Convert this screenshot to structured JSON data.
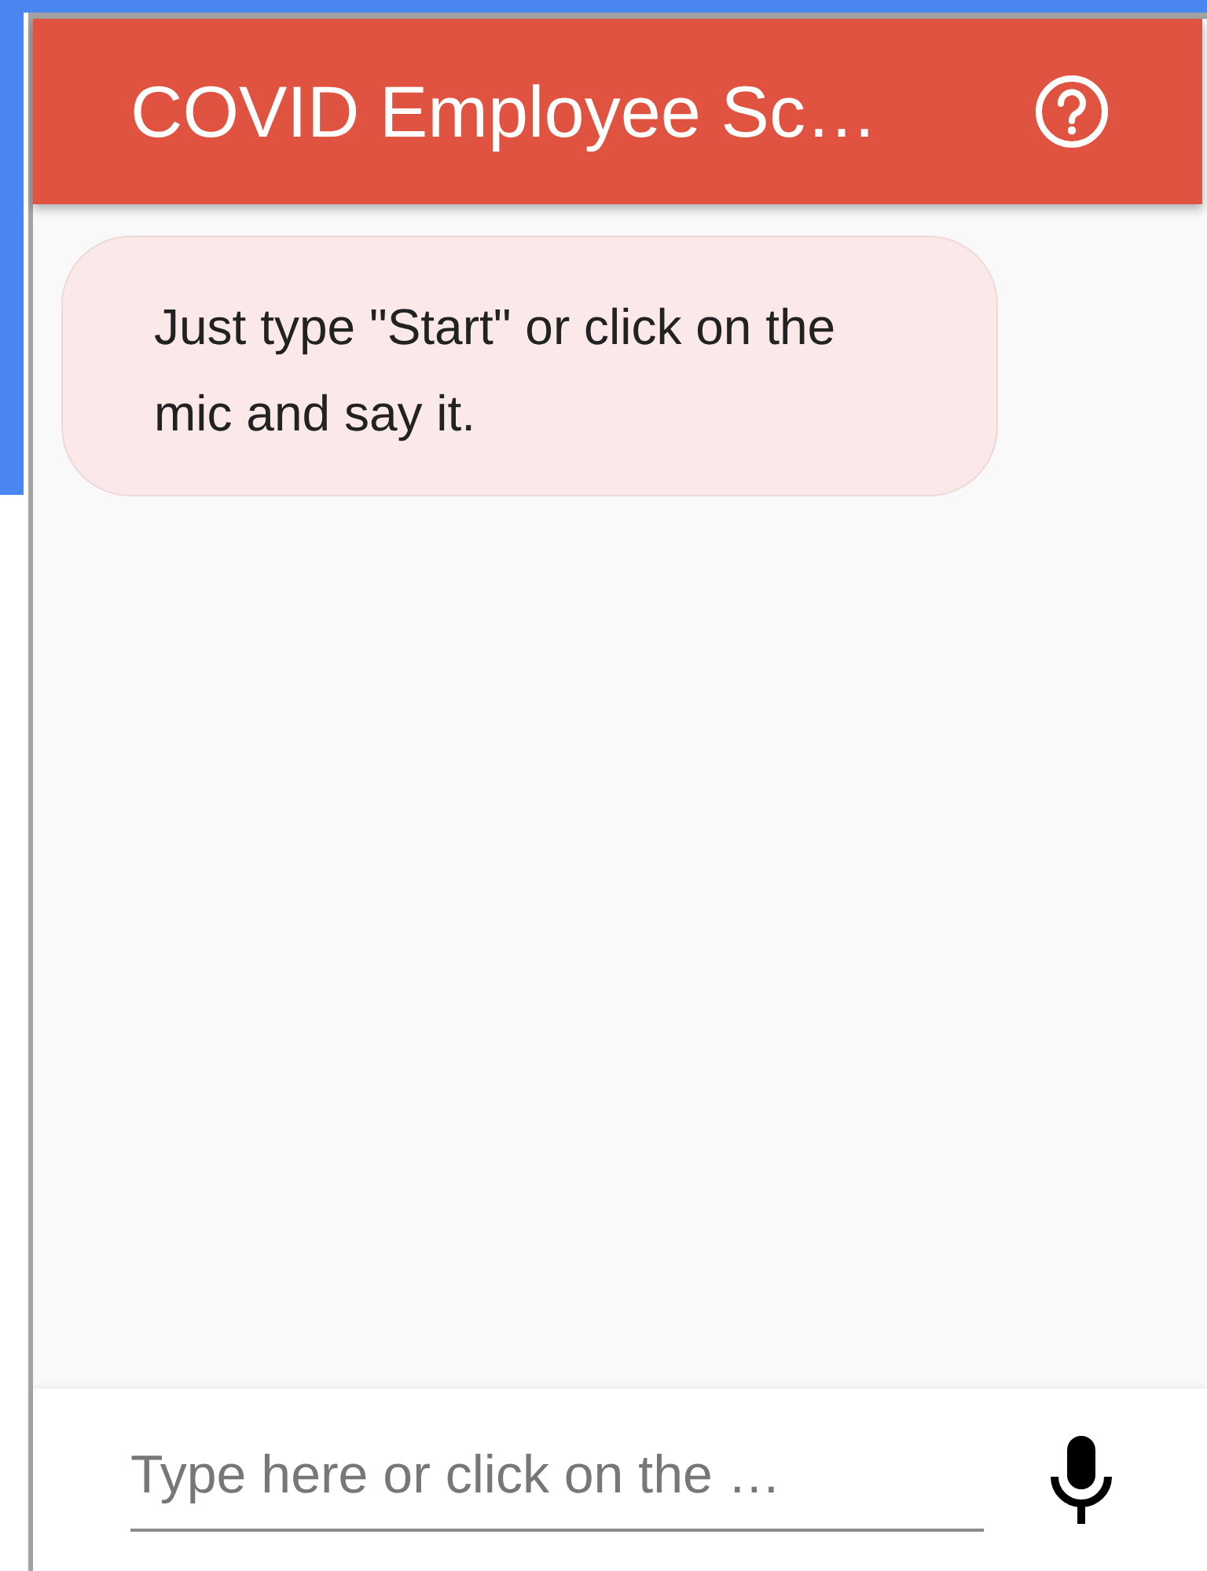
{
  "header": {
    "title": "COVID Employee Sc…"
  },
  "messages": [
    {
      "text": "Just type \"Start\" or click on the mic and say it."
    }
  ],
  "input": {
    "placeholder": "Type here or click on the …"
  }
}
